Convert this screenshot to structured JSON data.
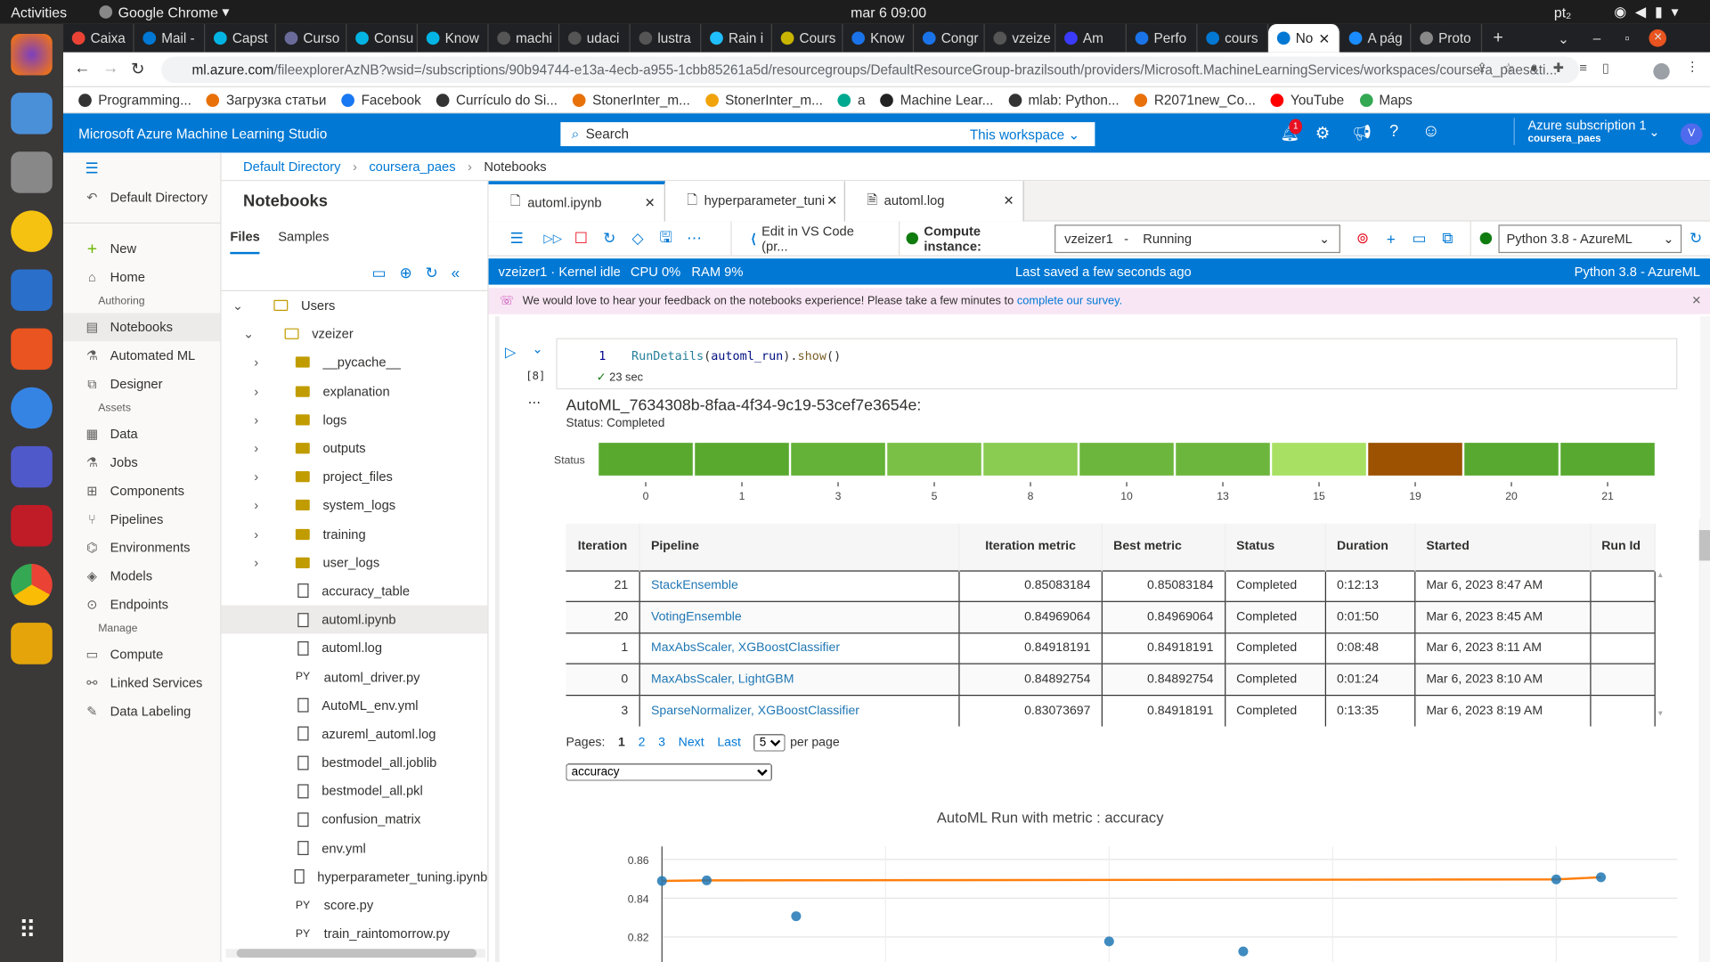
{
  "os": {
    "activities": "Activities",
    "app": "Google Chrome",
    "clock": "mar 6  09:00",
    "lang": "pt₂"
  },
  "browser": {
    "tabs": [
      "Caixa",
      "Mail -",
      "Capst",
      "Curso",
      "Consu",
      "Know",
      "machi",
      "udaci",
      "lustra",
      "Rain i",
      "Cours",
      "Know",
      "Congr",
      "vzeize",
      "Am",
      "Perfo",
      "cours",
      "No",
      "A pág",
      "Proto"
    ],
    "active_tab": 17,
    "url_host": "ml.azure.com",
    "url_path": "/fileexplorerAzNB?wsid=/subscriptions/90b94744-e13a-4ecb-a955-1cbb85261a5d/resourcegroups/DefaultResourceGroup-brazilsouth/providers/Microsoft.MachineLearningServices/workspaces/coursera_paes&ti...",
    "bookmarks": [
      "Programming...",
      "Загрузка статьи",
      "Facebook",
      "Currículo do Si...",
      "StonerInter_m...",
      "StonerInter_m...",
      "a",
      "Machine Lear...",
      "mlab: Python...",
      "R2071new_Co...",
      "YouTube",
      "Maps"
    ]
  },
  "header": {
    "title": "Microsoft Azure Machine Learning Studio",
    "search_placeholder": "Search",
    "scope": "This workspace",
    "notif_count": "1",
    "subscription": "Azure subscription 1",
    "workspace": "coursera_paes",
    "avatar": "V"
  },
  "nav": {
    "back": "Default Directory",
    "items": [
      {
        "label": "New",
        "icon": "+"
      },
      {
        "label": "Home",
        "icon": "⌂"
      }
    ],
    "authoring_label": "Authoring",
    "authoring": [
      {
        "label": "Notebooks",
        "icon": "▤",
        "selected": true
      },
      {
        "label": "Automated ML",
        "icon": "⚗"
      },
      {
        "label": "Designer",
        "icon": "⧉"
      }
    ],
    "assets_label": "Assets",
    "assets": [
      {
        "label": "Data",
        "icon": "▦"
      },
      {
        "label": "Jobs",
        "icon": "⚗"
      },
      {
        "label": "Components",
        "icon": "⊞"
      },
      {
        "label": "Pipelines",
        "icon": "⑂"
      },
      {
        "label": "Environments",
        "icon": "⌬"
      },
      {
        "label": "Models",
        "icon": "◈"
      },
      {
        "label": "Endpoints",
        "icon": "⊙"
      }
    ],
    "manage_label": "Manage",
    "manage": [
      {
        "label": "Compute",
        "icon": "▭"
      },
      {
        "label": "Linked Services",
        "icon": "⚯"
      },
      {
        "label": "Data Labeling",
        "icon": "✎"
      }
    ]
  },
  "breadcrumb": [
    "Default Directory",
    "coursera_paes",
    "Notebooks"
  ],
  "notebooks": {
    "title": "Notebooks",
    "tabs": [
      "Files",
      "Samples"
    ],
    "tree": [
      {
        "label": "Users",
        "type": "folder",
        "depth": 0,
        "expand": "down"
      },
      {
        "label": "vzeizer",
        "type": "folder",
        "depth": 1,
        "expand": "down"
      },
      {
        "label": "__pycache__",
        "type": "folder",
        "depth": 2,
        "expand": "right"
      },
      {
        "label": "explanation",
        "type": "folder",
        "depth": 2,
        "expand": "right"
      },
      {
        "label": "logs",
        "type": "folder",
        "depth": 2,
        "expand": "right"
      },
      {
        "label": "outputs",
        "type": "folder",
        "depth": 2,
        "expand": "right"
      },
      {
        "label": "project_files",
        "type": "folder",
        "depth": 2,
        "expand": "right"
      },
      {
        "label": "system_logs",
        "type": "folder",
        "depth": 2,
        "expand": "right"
      },
      {
        "label": "training",
        "type": "folder",
        "depth": 2,
        "expand": "right"
      },
      {
        "label": "user_logs",
        "type": "folder",
        "depth": 2,
        "expand": "right"
      },
      {
        "label": "accuracy_table",
        "type": "file",
        "depth": 2
      },
      {
        "label": "automl.ipynb",
        "type": "notebook",
        "depth": 2,
        "selected": true
      },
      {
        "label": "automl.log",
        "type": "file",
        "depth": 2
      },
      {
        "label": "automl_driver.py",
        "type": "py",
        "depth": 2
      },
      {
        "label": "AutoML_env.yml",
        "type": "file",
        "depth": 2
      },
      {
        "label": "azureml_automl.log",
        "type": "file",
        "depth": 2
      },
      {
        "label": "bestmodel_all.joblib",
        "type": "file",
        "depth": 2
      },
      {
        "label": "bestmodel_all.pkl",
        "type": "file",
        "depth": 2
      },
      {
        "label": "confusion_matrix",
        "type": "file",
        "depth": 2
      },
      {
        "label": "env.yml",
        "type": "file",
        "depth": 2
      },
      {
        "label": "hyperparameter_tuning.ipynb",
        "type": "notebook",
        "depth": 2
      },
      {
        "label": "score.py",
        "type": "py",
        "depth": 2
      },
      {
        "label": "train_raintomorrow.py",
        "type": "py",
        "depth": 2
      }
    ],
    "py_badge": "PY"
  },
  "editor": {
    "tabs": [
      "automl.ipynb",
      "hyperparameter_tuni",
      "automl.log"
    ],
    "toolbar": {
      "vscode": "Edit in VS Code (pr...",
      "compute_label": "Compute instance:",
      "compute_value": "vzeizer1   -    Running",
      "kernel": "Python 3.8 - AzureML"
    },
    "status": {
      "kernel": "vzeizer1 · Kernel idle",
      "cpu": "CPU  0%",
      "ram": "RAM  9%",
      "saved": "Last saved a few seconds ago",
      "python": "Python 3.8 - AzureML"
    },
    "banner": {
      "text": "We would love to hear your feedback on the notebooks experience! Please take a few minutes to ",
      "link": "complete our survey."
    },
    "cell": {
      "line": "1",
      "func": "RunDetails",
      "arg": "automl_run",
      "method": "show",
      "exec_count": "[8]",
      "elapsed": "23 sec"
    }
  },
  "output": {
    "run_id": "AutoML_7634308b-8faa-4f34-9c19-53cef7e3654e:",
    "status": "Status: Completed",
    "status_axis_label": "Status",
    "iterations": [
      "0",
      "1",
      "3",
      "5",
      "8",
      "10",
      "13",
      "15",
      "19",
      "20",
      "21"
    ],
    "status_colors": [
      "#59a92f",
      "#59a92f",
      "#64b237",
      "#7bc046",
      "#8acb52",
      "#6db63d",
      "#6db63d",
      "#a8e064",
      "#9c5200",
      "#57a92f",
      "#57a92f"
    ],
    "table": {
      "headers": [
        "Iteration",
        "Pipeline",
        "Iteration metric",
        "Best metric",
        "Status",
        "Duration",
        "Started",
        "Run Id"
      ],
      "rows": [
        [
          "21",
          "StackEnsemble",
          "0.85083184",
          "0.85083184",
          "Completed",
          "0:12:13",
          "Mar 6, 2023 8:47 AM",
          ""
        ],
        [
          "20",
          "VotingEnsemble",
          "0.84969064",
          "0.84969064",
          "Completed",
          "0:01:50",
          "Mar 6, 2023 8:45 AM",
          ""
        ],
        [
          "1",
          "MaxAbsScaler, XGBoostClassifier",
          "0.84918191",
          "0.84918191",
          "Completed",
          "0:08:48",
          "Mar 6, 2023 8:11 AM",
          ""
        ],
        [
          "0",
          "MaxAbsScaler, LightGBM",
          "0.84892754",
          "0.84892754",
          "Completed",
          "0:01:24",
          "Mar 6, 2023 8:10 AM",
          ""
        ],
        [
          "3",
          "SparseNormalizer, XGBoostClassifier",
          "0.83073697",
          "0.84918191",
          "Completed",
          "0:13:35",
          "Mar 6, 2023 8:19 AM",
          ""
        ]
      ]
    },
    "pager": {
      "label": "Pages:",
      "pages": [
        "1",
        "2",
        "3"
      ],
      "next": "Next",
      "last": "Last",
      "per_page_value": "5",
      "per_page": "per page"
    },
    "metric_select": "accuracy"
  },
  "chart_data": {
    "type": "scatter",
    "title": "AutoML Run with metric : accuracy",
    "ylim": [
      0.808,
      0.866
    ],
    "xlim": [
      0,
      22.5
    ],
    "yticks": [
      0.82,
      0.84,
      0.86
    ],
    "xgrid": [
      0,
      5,
      10,
      15,
      20
    ],
    "grid": true,
    "series": [
      {
        "kind": "points",
        "color": "#1f77b4",
        "x": [
          0,
          1,
          3,
          10,
          13,
          20,
          21
        ],
        "y": [
          0.8489,
          0.8492,
          0.8307,
          0.8177,
          0.8125,
          0.8497,
          0.8508
        ]
      },
      {
        "kind": "best-line",
        "color": "#ff7f0e",
        "x": [
          0,
          1,
          20,
          21
        ],
        "y": [
          0.8489,
          0.8492,
          0.8497,
          0.8508
        ]
      }
    ]
  }
}
